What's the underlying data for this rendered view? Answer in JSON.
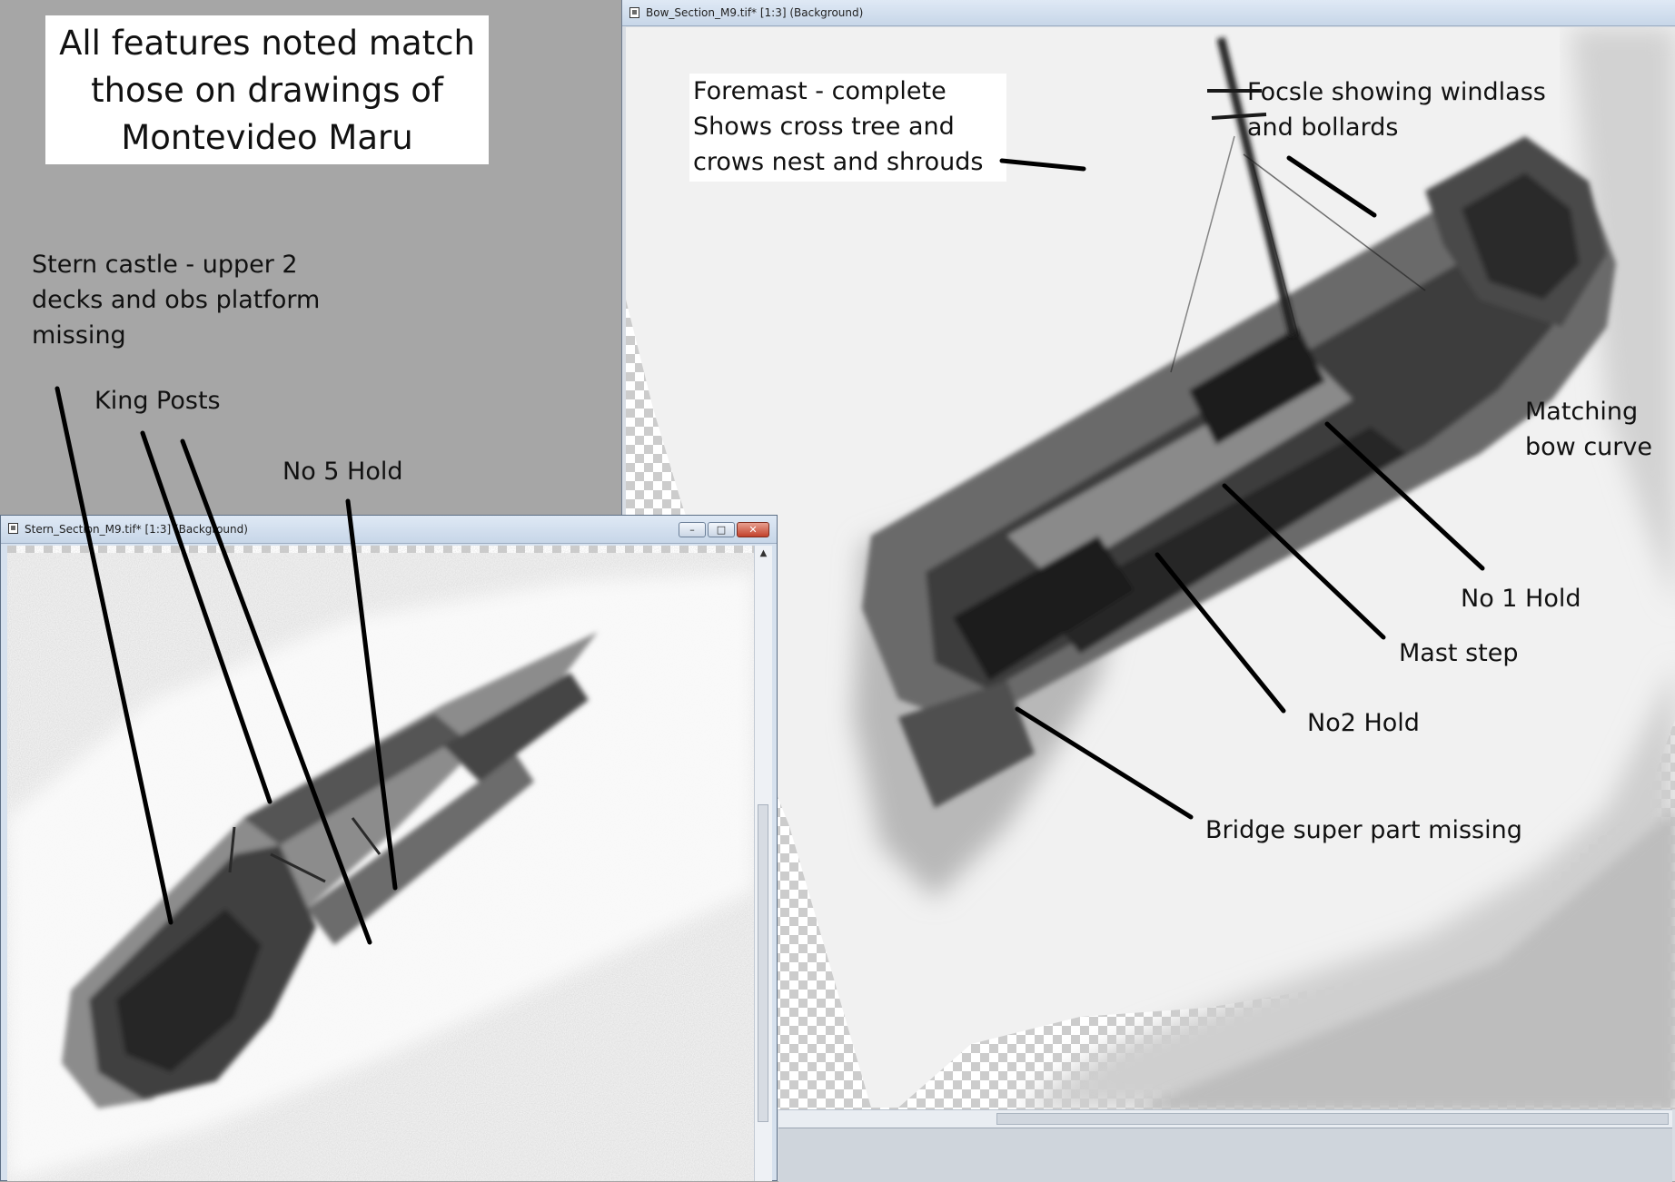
{
  "windows": {
    "bow": {
      "title": "Bow_Section_M9.tif* [1:3] (Background)"
    },
    "stern": {
      "title": "Stern_Section_M9.tif* [1:3] (Background)",
      "controls": {
        "minimize": "–",
        "maximize": "□",
        "close": "✕"
      },
      "scroll_up": "▲"
    }
  },
  "caption": "All features noted match\nthose on drawings of\nMontevideo Maru",
  "annotations": {
    "stern_castle": "Stern castle - upper 2\ndecks and obs platform\nmissing",
    "king_posts": "King Posts",
    "no5_hold": "No 5 Hold",
    "foremast": "Foremast - complete\nShows cross tree and\ncrows nest and shrouds",
    "focsle": "Focsle showing windlass\nand bollards",
    "bow_curve": "Matching\nbow curve",
    "no1_hold": "No 1 Hold",
    "mast_step": "Mast step",
    "no2_hold": "No2 Hold",
    "bridge": "Bridge super part missing"
  },
  "colors": {
    "background": "#a6a6a6",
    "sonar_dark": "#1a1a1a",
    "leader_line": "#000000"
  },
  "icons": {
    "document": "document-icon"
  }
}
